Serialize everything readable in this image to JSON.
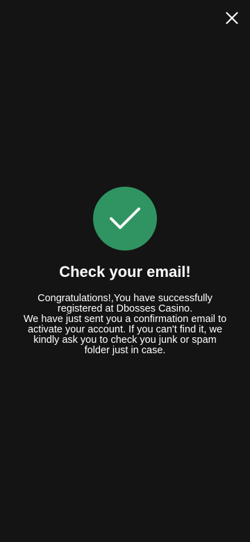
{
  "modal": {
    "close_icon": "close-icon",
    "success_icon": "checkmark-icon",
    "accent_color": "#2f9461",
    "title": "Check your email!",
    "message_line1": "Congratulations!,You have successfully registered at Dbosses Casino.",
    "message_line2": "We have just sent you a confirmation email to activate your account. If you can't find it, we kindly ask you to check you junk or spam folder just in case."
  }
}
